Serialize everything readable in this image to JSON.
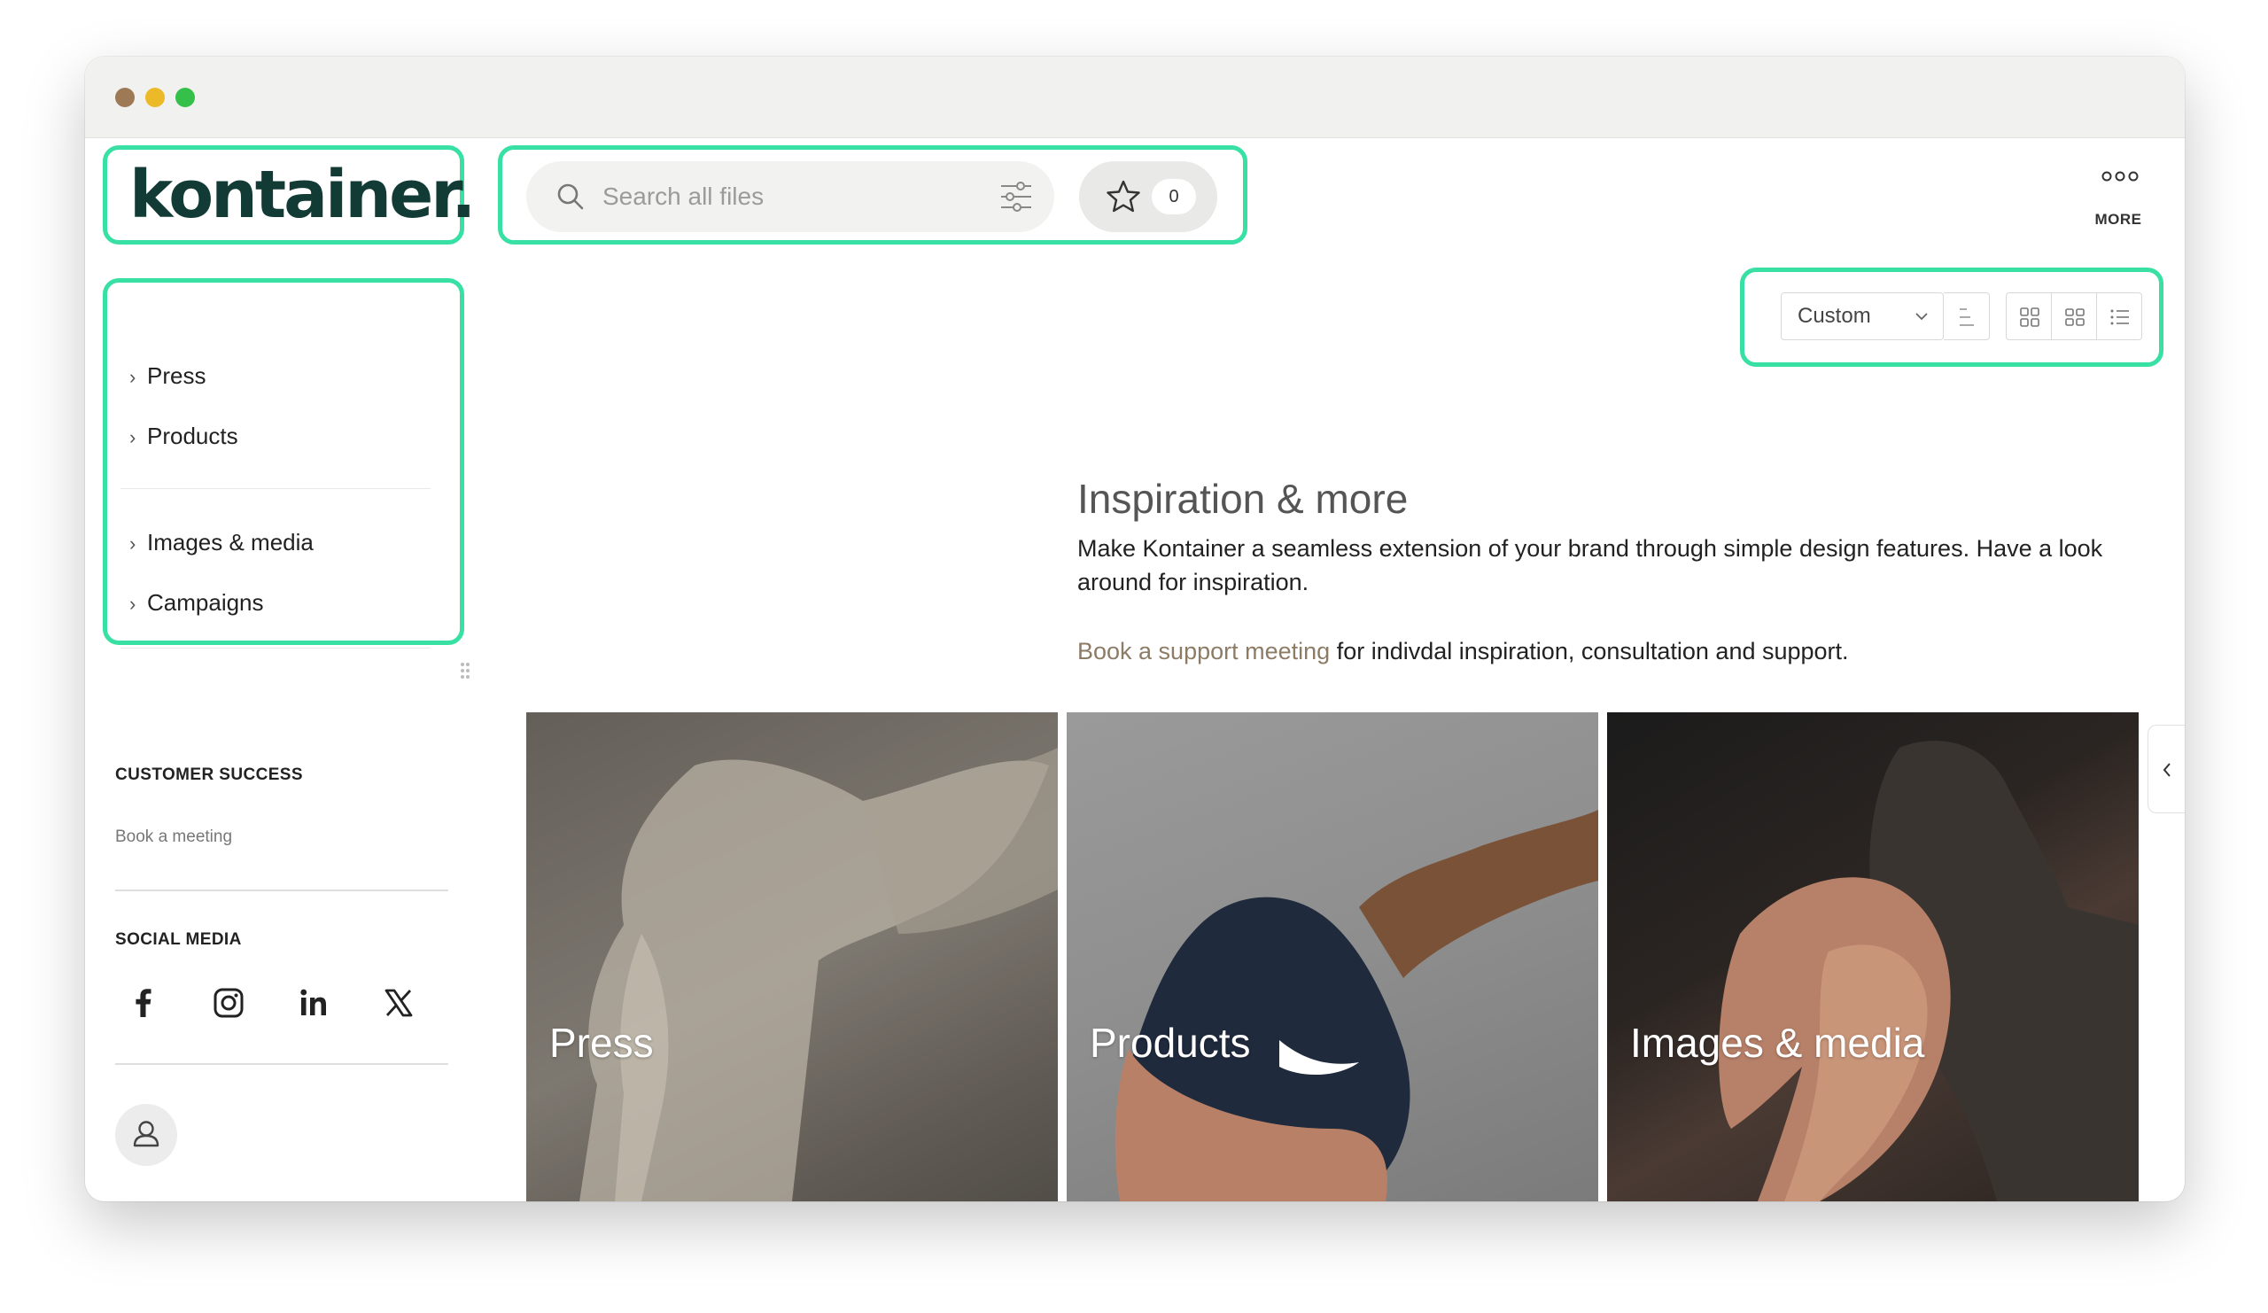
{
  "brand": {
    "logo_text": "kontainer."
  },
  "search": {
    "placeholder": "Search all files"
  },
  "favorites": {
    "count": "0"
  },
  "more": {
    "label": "MORE"
  },
  "nav": {
    "items": [
      {
        "label": "Press"
      },
      {
        "label": "Products"
      },
      {
        "label": "Images & media"
      },
      {
        "label": "Campaigns"
      }
    ]
  },
  "sidebar": {
    "customer_success": {
      "heading": "CUSTOMER SUCCESS",
      "link": "Book a meeting"
    },
    "social_media": {
      "heading": "SOCIAL MEDIA",
      "icons": [
        "facebook-icon",
        "instagram-icon",
        "linkedin-icon",
        "x-icon"
      ]
    }
  },
  "toolbar": {
    "sort_value": "Custom"
  },
  "hero": {
    "title": "Inspiration & more",
    "text": "Make Kontainer a seamless extension of your brand through simple design features. Have a look around for inspiration.",
    "link_text": "Book a support meeting",
    "link_suffix": " for indivdal inspiration, consultation and support."
  },
  "tiles": [
    {
      "label": "Press"
    },
    {
      "label": "Products"
    },
    {
      "label": "Images & media"
    }
  ],
  "colors": {
    "highlight": "#38e0a4",
    "brand": "#123b35",
    "link": "#8d7b66"
  }
}
